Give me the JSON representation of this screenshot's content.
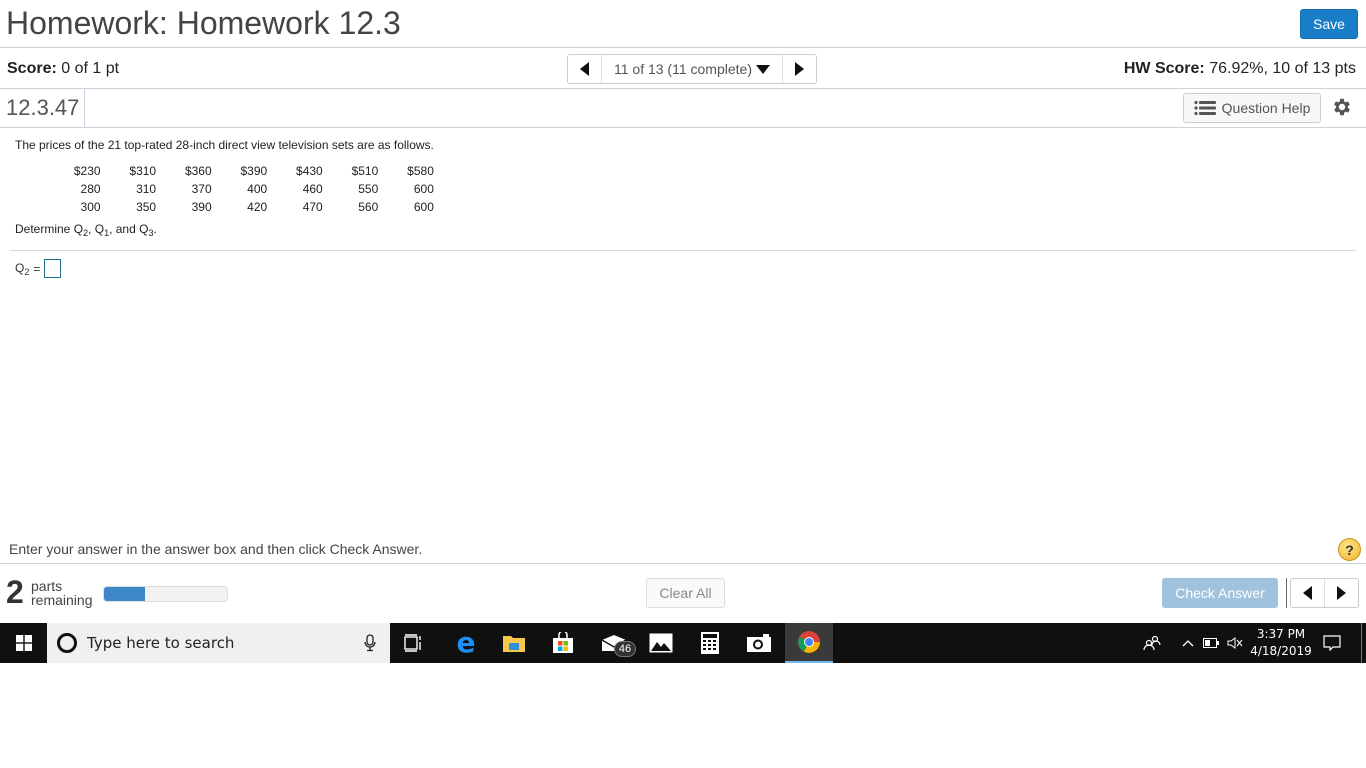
{
  "header": {
    "title": "Homework: Homework 12.3",
    "save_label": "Save"
  },
  "score_bar": {
    "score_label": "Score:",
    "score_value": "0 of 1 pt",
    "nav_label": "11 of 13 (11 complete)",
    "hw_score_label": "HW Score:",
    "hw_score_value": "76.92%, 10 of 13 pts"
  },
  "question_bar": {
    "number": "12.3.47",
    "help_label": "Question Help"
  },
  "question": {
    "intro": "The prices of the 21 top-rated 28-inch direct view television sets are as follows.",
    "prices": [
      [
        "$230",
        "$310",
        "$360",
        "$390",
        "$430",
        "$510",
        "$580"
      ],
      [
        "280",
        "310",
        "370",
        "400",
        "460",
        "550",
        "600"
      ],
      [
        "300",
        "350",
        "390",
        "420",
        "470",
        "560",
        "600"
      ]
    ],
    "determine_prefix": "Determine Q",
    "determine_parts": [
      "2",
      ", Q",
      "1",
      ", and Q",
      "3",
      "."
    ],
    "answer_label": "Q",
    "answer_sub": "2",
    "answer_eq": "=",
    "answer_value": ""
  },
  "footer": {
    "instruction": "Enter your answer in the answer box and then click Check Answer.",
    "parts_count": "2",
    "parts_word1": "parts",
    "parts_word2": "remaining",
    "progress_percent": 33,
    "clear_label": "Clear All",
    "check_label": "Check Answer"
  },
  "taskbar": {
    "search_placeholder": "Type here to search",
    "mail_badge": "46",
    "time": "3:37 PM",
    "date": "4/18/2019"
  },
  "colors": {
    "save_blue": "#1a7dc8",
    "check_disabled": "#a0c2dd",
    "progress_fill": "#3d87c9",
    "answer_border": "#1d6f8d"
  }
}
